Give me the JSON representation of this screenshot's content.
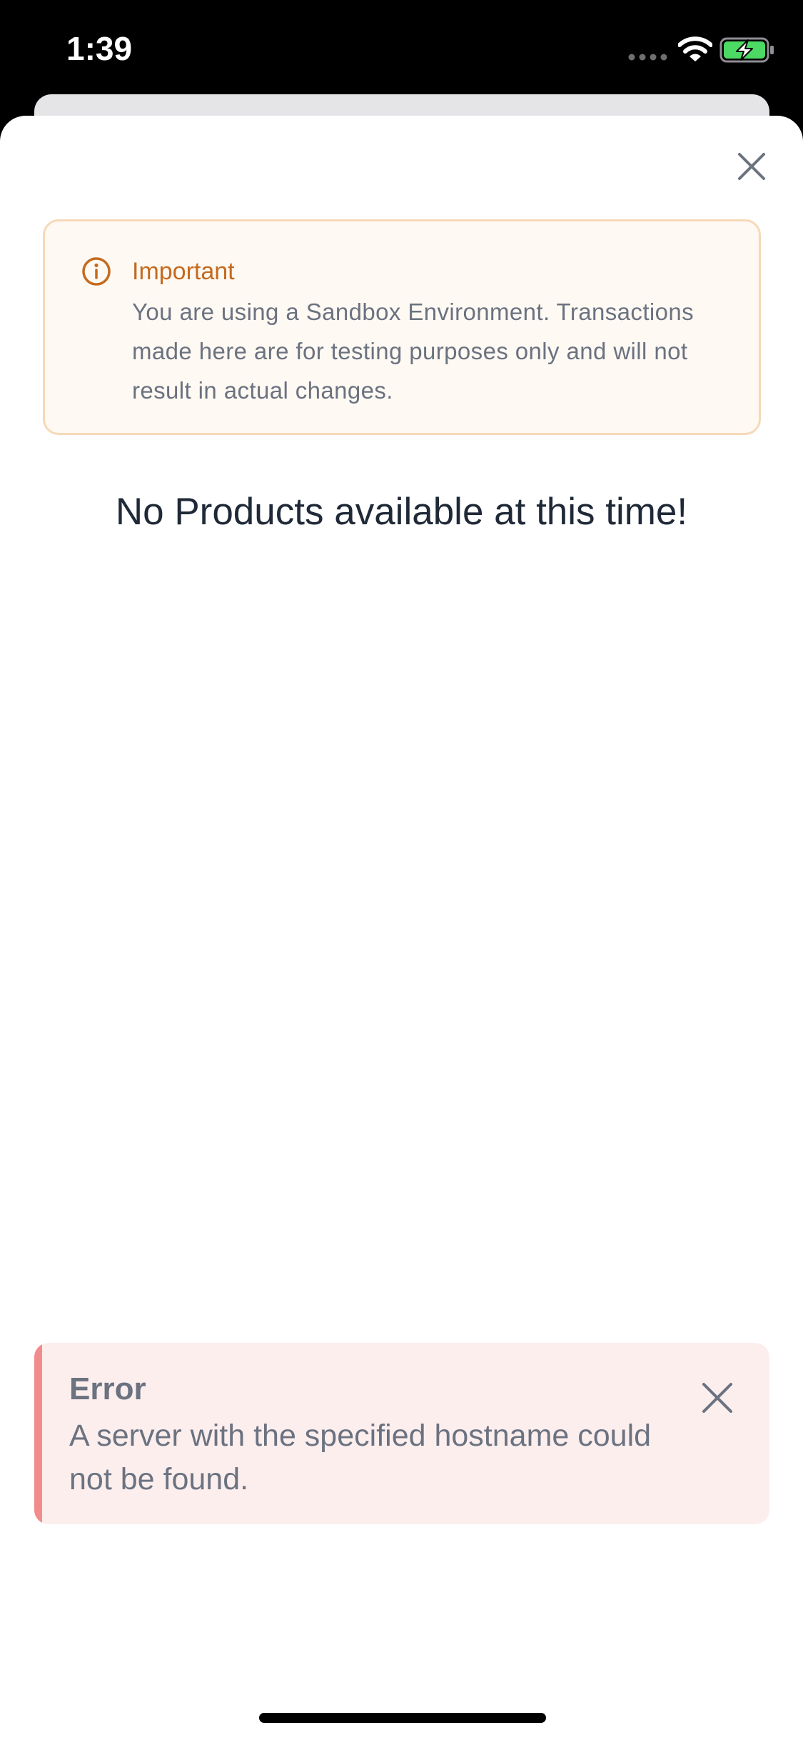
{
  "status_bar": {
    "time": "1:39",
    "icons": [
      "cellular-signal-icon",
      "wifi-icon",
      "battery-charging-icon"
    ],
    "battery_color": "#4cd964"
  },
  "sheet": {
    "close_icon": "close-icon"
  },
  "notice": {
    "icon": "info-circle-icon",
    "title": "Important",
    "body": "You are using a Sandbox Environment. Transactions made here are for testing purposes only and will not result in actual changes.",
    "accent_color": "#c56a1e",
    "background_color": "#fef9f3"
  },
  "products": {
    "empty_message": "No Products available at this time!"
  },
  "error_toast": {
    "title": "Error",
    "message": "A server with the specified hostname could not be found.",
    "close_icon": "close-icon",
    "accent_color": "#f28b8b",
    "background_color": "#fdeeee"
  }
}
